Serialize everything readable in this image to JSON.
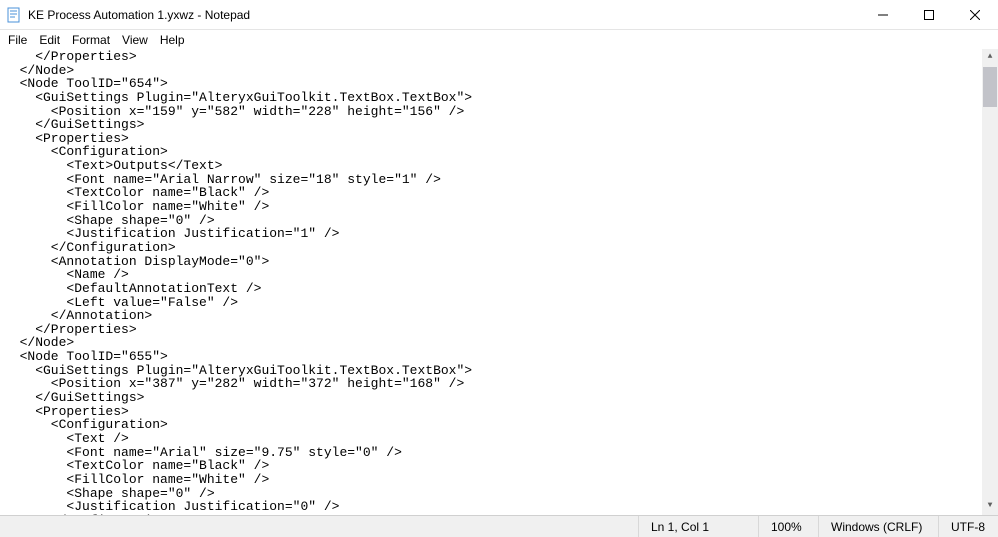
{
  "window": {
    "title": "KE Process Automation 1.yxwz - Notepad"
  },
  "menu": {
    "file": "File",
    "edit": "Edit",
    "format": "Format",
    "view": "View",
    "help": "Help"
  },
  "editor": {
    "text": "    </Properties>\n  </Node>\n  <Node ToolID=\"654\">\n    <GuiSettings Plugin=\"AlteryxGuiToolkit.TextBox.TextBox\">\n      <Position x=\"159\" y=\"582\" width=\"228\" height=\"156\" />\n    </GuiSettings>\n    <Properties>\n      <Configuration>\n        <Text>Outputs</Text>\n        <Font name=\"Arial Narrow\" size=\"18\" style=\"1\" />\n        <TextColor name=\"Black\" />\n        <FillColor name=\"White\" />\n        <Shape shape=\"0\" />\n        <Justification Justification=\"1\" />\n      </Configuration>\n      <Annotation DisplayMode=\"0\">\n        <Name />\n        <DefaultAnnotationText />\n        <Left value=\"False\" />\n      </Annotation>\n    </Properties>\n  </Node>\n  <Node ToolID=\"655\">\n    <GuiSettings Plugin=\"AlteryxGuiToolkit.TextBox.TextBox\">\n      <Position x=\"387\" y=\"282\" width=\"372\" height=\"168\" />\n    </GuiSettings>\n    <Properties>\n      <Configuration>\n        <Text />\n        <Font name=\"Arial\" size=\"9.75\" style=\"0\" />\n        <TextColor name=\"Black\" />\n        <FillColor name=\"White\" />\n        <Shape shape=\"0\" />\n        <Justification Justification=\"0\" />\n      </Configuration>"
  },
  "status": {
    "position": "Ln 1, Col 1",
    "zoom": "100%",
    "line_ending": "Windows (CRLF)",
    "encoding": "UTF-8"
  }
}
